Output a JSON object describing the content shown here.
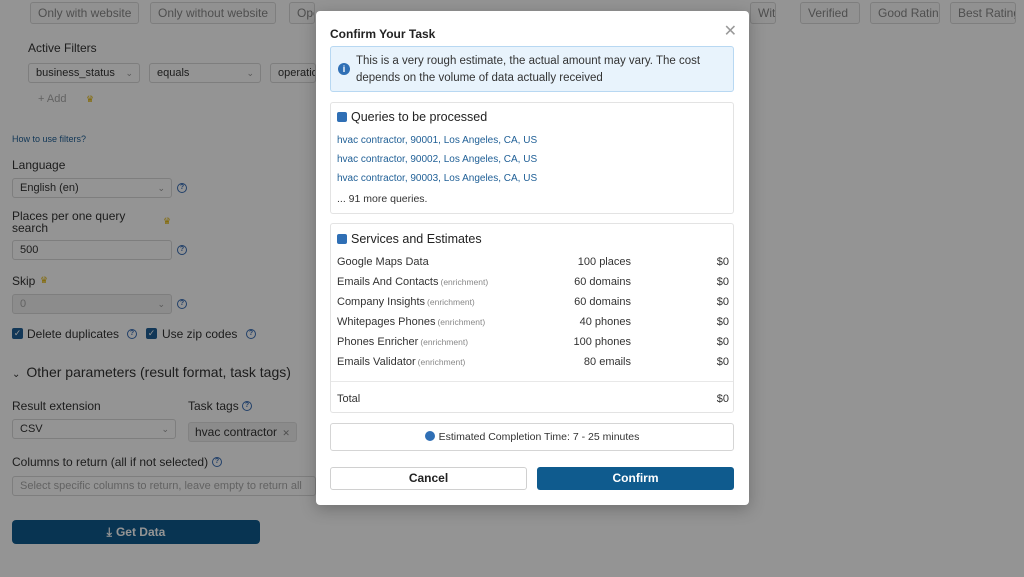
{
  "background": {
    "filter_chips": [
      "Only with website",
      "Only without website",
      "Operational",
      "With phone",
      "Verified",
      "Good Rating",
      "Best Rating"
    ],
    "active_filters_title": "Active Filters",
    "filter": {
      "field": "business_status",
      "operator": "equals",
      "value": "operational"
    },
    "add_label": "+ Add",
    "how_to_link": "How to use filters?",
    "language_label": "Language",
    "language_value": "English (en)",
    "places_label_line1": "Places per one query",
    "places_label_line2": "search",
    "places_value": "500",
    "skip_label": "Skip",
    "skip_value": "0",
    "delete_duplicates_label": "Delete duplicates",
    "use_zip_codes_label": "Use zip codes",
    "other_params_label": "Other parameters (result format, task tags)",
    "result_extension_label": "Result extension",
    "result_extension_value": "CSV",
    "task_tags_label": "Task tags",
    "task_tag_value": "hvac contractor",
    "columns_label": "Columns to return (all if not selected)",
    "columns_placeholder": "Select specific columns to return, leave empty to return all",
    "get_data_label": "Get Data"
  },
  "modal": {
    "title": "Confirm Your Task",
    "info_text": "This is a very rough estimate, the actual amount may vary. The cost depends on the volume of data actually received",
    "queries_title": "Queries to be processed",
    "queries": [
      "hvac contractor, 90001, Los Angeles, CA, US",
      "hvac contractor, 90002, Los Angeles, CA, US",
      "hvac contractor, 90003, Los Angeles, CA, US"
    ],
    "more_queries": "... 91 more queries.",
    "services_title": "Services and Estimates",
    "services": [
      {
        "name": "Google Maps Data",
        "tag": "",
        "qty": "100 places",
        "cost": "$0"
      },
      {
        "name": "Emails And Contacts",
        "tag": "(enrichment)",
        "qty": "60 domains",
        "cost": "$0"
      },
      {
        "name": "Company Insights",
        "tag": "(enrichment)",
        "qty": "60 domains",
        "cost": "$0"
      },
      {
        "name": "Whitepages Phones",
        "tag": "(enrichment)",
        "qty": "40 phones",
        "cost": "$0"
      },
      {
        "name": "Phones Enricher",
        "tag": "(enrichment)",
        "qty": "100 phones",
        "cost": "$0"
      },
      {
        "name": "Emails Validator",
        "tag": "(enrichment)",
        "qty": "80 emails",
        "cost": "$0"
      }
    ],
    "total_label": "Total",
    "total_value": "$0",
    "eta_label": "Estimated Completion Time:",
    "eta_value": "7 - 25 minutes",
    "cancel_label": "Cancel",
    "confirm_label": "Confirm"
  },
  "colors": {
    "primary": "#0f5b8e",
    "info_bg": "#e8f3fc",
    "link": "#1f5f96"
  }
}
